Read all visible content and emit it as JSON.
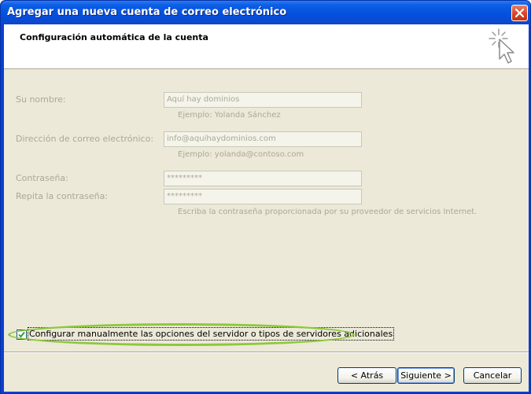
{
  "window": {
    "title": "Agregar una nueva cuenta de correo electrónico"
  },
  "header": {
    "title": "Configuración automática de la cuenta",
    "icon": "wizard-cursor-icon"
  },
  "form": {
    "name": {
      "label": "Su nombre:",
      "value": "Aquí hay dominios",
      "hint": "Ejemplo: Yolanda Sánchez",
      "enabled": false
    },
    "email": {
      "label": "Dirección de correo electrónico:",
      "value": "info@aquihaydominios.com",
      "hint": "Ejemplo: yolanda@contoso.com",
      "enabled": false
    },
    "password": {
      "label": "Contraseña:",
      "value": "*********",
      "enabled": false
    },
    "password_confirm": {
      "label": "Repita la contraseña:",
      "value": "*********",
      "enabled": false
    },
    "password_hint": "Escriba la contraseña proporcionada por su proveedor de servicios Internet."
  },
  "manual_config": {
    "label": "Configurar manualmente las opciones del servidor o tipos de servidores adicionales",
    "checked": true,
    "highlight_color": "#8cc83c"
  },
  "buttons": {
    "back": "< Atrás",
    "next": "Siguiente >",
    "cancel": "Cancelar"
  },
  "colors": {
    "titlebar": "#0551dc",
    "dialog_bg": "#ece9d8",
    "disabled_text": "#aca899"
  }
}
